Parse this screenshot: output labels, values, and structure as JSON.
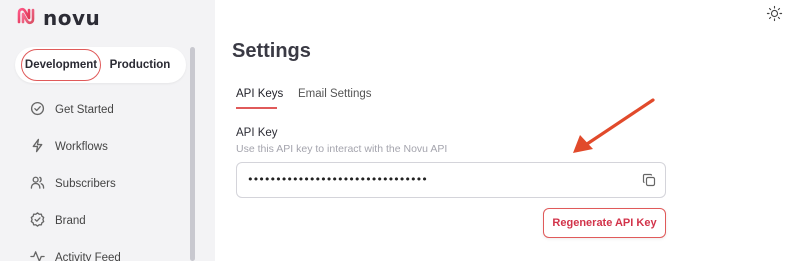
{
  "brand": {
    "name": "novu"
  },
  "environment": {
    "options": [
      "Development",
      "Production"
    ],
    "selected": "Development"
  },
  "sidebar": {
    "items": [
      {
        "label": "Get Started",
        "icon": "check-circle-icon"
      },
      {
        "label": "Workflows",
        "icon": "lightning-icon"
      },
      {
        "label": "Subscribers",
        "icon": "users-icon"
      },
      {
        "label": "Brand",
        "icon": "badge-check-icon"
      },
      {
        "label": "Activity Feed",
        "icon": "activity-icon"
      }
    ]
  },
  "page": {
    "title": "Settings",
    "tabs": [
      {
        "label": "API Keys",
        "active": true
      },
      {
        "label": "Email Settings",
        "active": false
      }
    ],
    "api_key": {
      "label": "API Key",
      "description": "Use this API key to interact with the Novu API",
      "value": "••••••••••••••••••••••••••••••••",
      "copy_icon": "copy-icon"
    },
    "regenerate_label": "Regenerate API Key"
  },
  "colors": {
    "accent": "#e05a5a",
    "annotation_arrow": "#e14a2b",
    "sidebar_bg": "#f3f3f5"
  }
}
